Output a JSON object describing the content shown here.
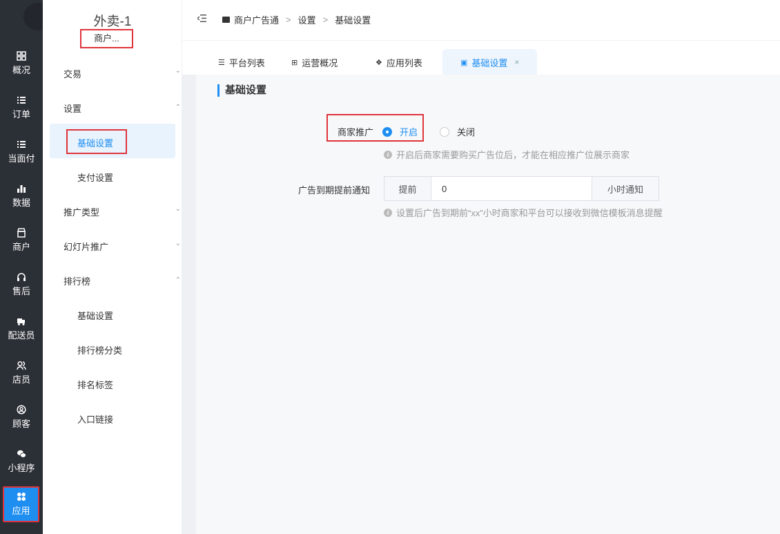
{
  "rail": {
    "items": [
      {
        "label": "概况",
        "icon": "dashboard-icon"
      },
      {
        "label": "订单",
        "icon": "list-icon"
      },
      {
        "label": "当面付",
        "icon": "list-icon"
      },
      {
        "label": "数据",
        "icon": "bar-chart-icon"
      },
      {
        "label": "商户",
        "icon": "store-icon"
      },
      {
        "label": "售后",
        "icon": "headset-icon"
      },
      {
        "label": "配送员",
        "icon": "delivery-icon"
      },
      {
        "label": "店员",
        "icon": "users-icon"
      },
      {
        "label": "顾客",
        "icon": "user-circle-icon"
      },
      {
        "label": "小程序",
        "icon": "wechat-icon"
      },
      {
        "label": "应用",
        "icon": "apps-icon"
      }
    ]
  },
  "sidebar": {
    "store_name": "外卖-1",
    "store_sub": "商户...",
    "groups": [
      {
        "label": "交易",
        "expanded": false
      },
      {
        "label": "设置",
        "expanded": true
      },
      {
        "label": "推广类型",
        "expanded": false
      },
      {
        "label": "幻灯片推广",
        "expanded": false
      },
      {
        "label": "排行榜",
        "expanded": true
      }
    ],
    "settings_items": [
      "基础设置",
      "支付设置"
    ],
    "ranking_items": [
      "基础设置",
      "排行榜分类",
      "排名标签",
      "入口链接"
    ]
  },
  "breadcrumb": {
    "items": [
      "商户广告通",
      "设置",
      "基础设置"
    ],
    "separator": ">"
  },
  "tabs": [
    {
      "label": "平台列表",
      "icon": "list-icon"
    },
    {
      "label": "运营概况",
      "icon": "grid-icon"
    },
    {
      "label": "应用列表",
      "icon": "apps-icon"
    },
    {
      "label": "基础设置",
      "icon": "monitor-icon",
      "active": true,
      "close": "×"
    }
  ],
  "main": {
    "section_title": "基础设置",
    "promo_label": "商家推广",
    "radio_on": "开启",
    "radio_off": "关闭",
    "promo_hint": "开启后商家需要购买广告位后，才能在相应推广位展示商家",
    "notify_label": "广告到期提前通知",
    "notify_prefix": "提前",
    "notify_value": "0",
    "notify_suffix": "小时通知",
    "notify_hint": "设置后广告到期前“xx”小时商家和平台可以接收到微信模板消息提醒"
  },
  "colors": {
    "accent": "#1f8ef1",
    "rail_bg": "#2b2f36",
    "highlight": "#e0333a"
  }
}
